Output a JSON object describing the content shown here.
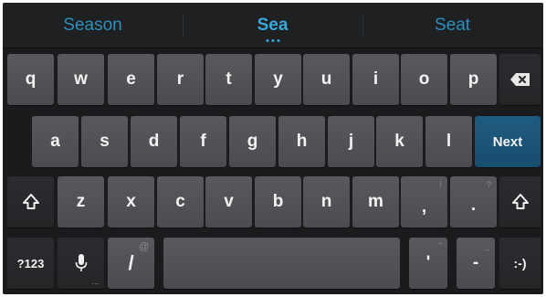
{
  "suggestions": [
    {
      "label": "Season"
    },
    {
      "label": "Sea"
    },
    {
      "label": "Seat"
    }
  ],
  "rows": {
    "row1": [
      "q",
      "w",
      "e",
      "r",
      "t",
      "y",
      "u",
      "i",
      "o",
      "p"
    ],
    "row2": [
      "a",
      "s",
      "d",
      "f",
      "g",
      "h",
      "j",
      "k",
      "l"
    ],
    "row3": [
      "z",
      "x",
      "c",
      "v",
      "b",
      "n",
      "m",
      ",",
      "."
    ]
  },
  "hints": {
    "comma": "!",
    "period": "?",
    "slash": "@",
    "apostrophe": "\"",
    "dash": "_",
    "mic": "..."
  },
  "keys": {
    "next": "Next",
    "symbols": "?123",
    "slash": "/",
    "apostrophe": "'",
    "dash": "-",
    "smiley": ":-)"
  },
  "colors": {
    "background": "#191b1d",
    "key": "#525457",
    "key_dark": "#27292c",
    "action_key": "#1b5577",
    "suggestion_text": "#2d8fbd",
    "selected_suggestion": "#37a9de"
  },
  "icons": {
    "backspace": "backspace-icon",
    "shift": "shift-icon",
    "mic": "microphone-icon"
  }
}
